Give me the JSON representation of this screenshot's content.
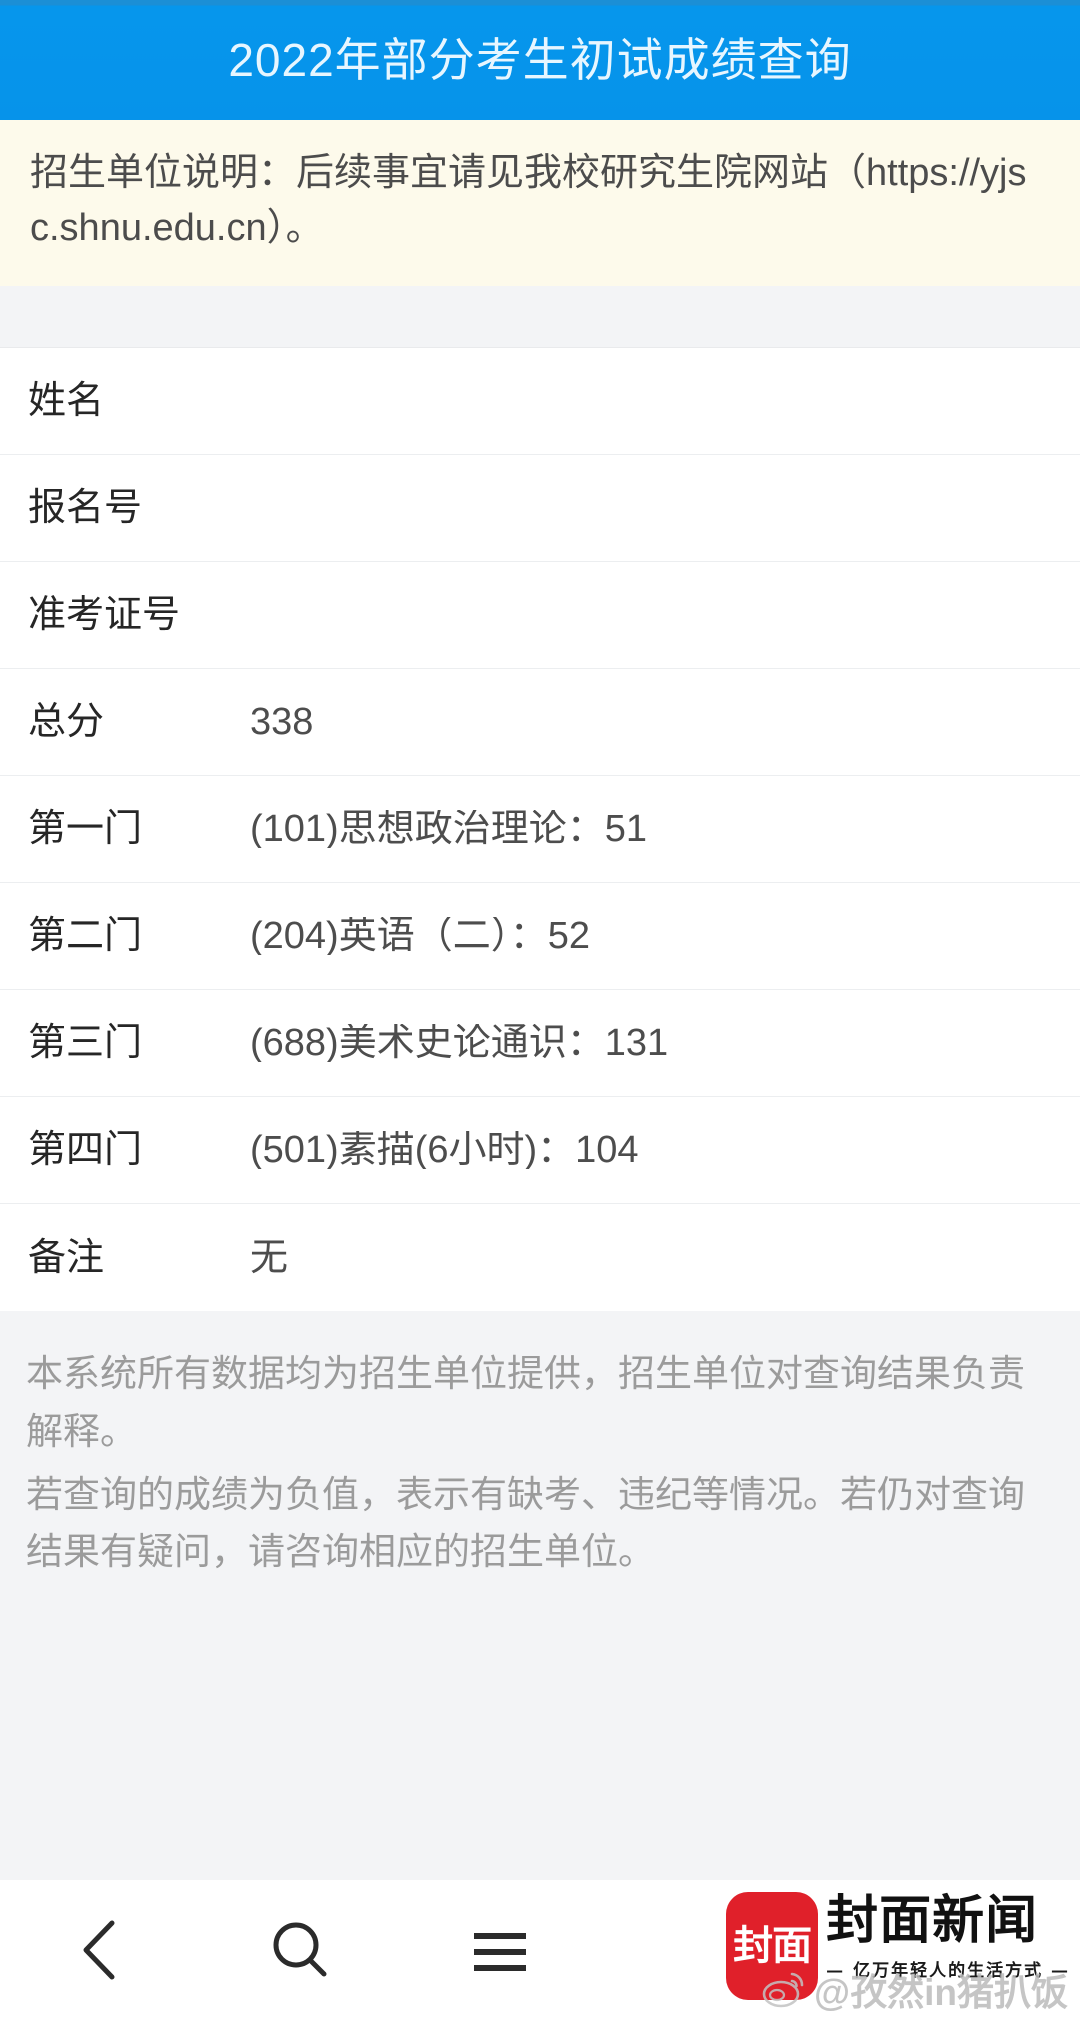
{
  "header": {
    "title": "2022年部分考生初试成绩查询",
    "background_color": "#0693ea",
    "text_color": "#e7f6ff"
  },
  "notice": {
    "text": "招生单位说明：后续事宜请见我校研究生院网站（https://yjsc.shnu.edu.cn）。",
    "background_color": "#fdfaeb"
  },
  "result": {
    "rows": [
      {
        "label": "姓名",
        "value": ""
      },
      {
        "label": "报名号",
        "value": ""
      },
      {
        "label": "准考证号",
        "value": ""
      },
      {
        "label": "总分",
        "value": "338"
      },
      {
        "label": "第一门",
        "value": "(101)思想政治理论：51"
      },
      {
        "label": "第二门",
        "value": "(204)英语（二）：52"
      },
      {
        "label": "第三门",
        "value": "(688)美术史论通识：131"
      },
      {
        "label": "第四门",
        "value": "(501)素描(6小时)：104"
      },
      {
        "label": "备注",
        "value": "无"
      }
    ]
  },
  "footer_note": {
    "line1": "本系统所有数据均为招生单位提供，招生单位对查询结果负责解释。",
    "line2": "若查询的成绩为负值，表示有缺考、违纪等情况。若仍对查询结果有疑问，请咨询相应的招生单位。"
  },
  "bottom_bar": {
    "back_label": "back-chevron",
    "search_label": "search",
    "menu_label": "menu"
  },
  "logo": {
    "mark_text": "封面",
    "name": "封面新闻",
    "tagline": "— 亿万年轻人的生活方式 —",
    "mark_color": "#e0202a"
  },
  "watermark": {
    "handle": "@孜然in猪扒饭"
  }
}
